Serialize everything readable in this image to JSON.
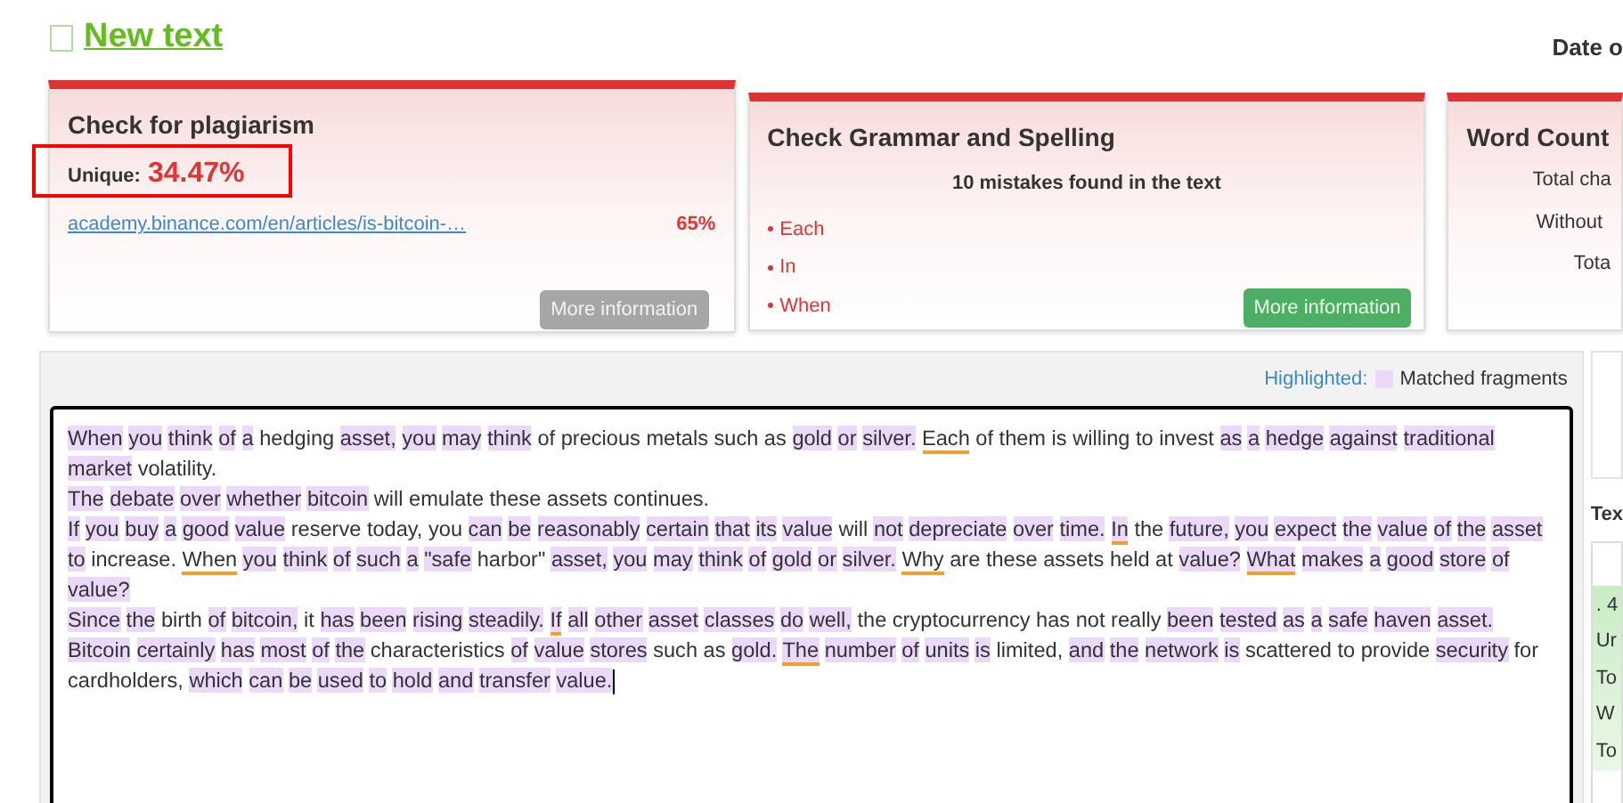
{
  "header": {
    "title": "New text",
    "checked": false,
    "date_label": "Date o"
  },
  "plagiarism": {
    "title": "Check for plagiarism",
    "unique_label": "Unique:",
    "unique_value": "34.47%",
    "sources": [
      {
        "url": "academy.binance.com/en/articles/is-bitcoin-…",
        "percent": "65%"
      }
    ],
    "button": "More information"
  },
  "grammar": {
    "title": "Check Grammar and Spelling",
    "summary": "10 mistakes found in the text",
    "mistakes": [
      "Each",
      "In",
      "When"
    ],
    "button": "More information"
  },
  "word_count": {
    "title": "Word Count",
    "rows": [
      "Total cha",
      "Without",
      "Tota"
    ]
  },
  "editor": {
    "legend_label": "Highlighted:",
    "legend_text": "Matched fragments",
    "paragraphs": [
      [
        {
          "text": "When",
          "kind": "match"
        },
        {
          "text": "you",
          "kind": "match"
        },
        {
          "text": "think",
          "kind": "match"
        },
        {
          "text": "of",
          "kind": "match"
        },
        {
          "text": "a",
          "kind": "match"
        },
        {
          "text": "hedging",
          "kind": "plain"
        },
        {
          "text": "asset,",
          "kind": "match"
        },
        {
          "text": "you",
          "kind": "match"
        },
        {
          "text": "may",
          "kind": "match"
        },
        {
          "text": "think",
          "kind": "match"
        },
        {
          "text": "of precious metals such as",
          "kind": "plain"
        },
        {
          "text": "gold",
          "kind": "match"
        },
        {
          "text": "or",
          "kind": "match"
        },
        {
          "text": "silver.",
          "kind": "match"
        },
        {
          "text": "Each",
          "kind": "error"
        },
        {
          "text": "of them is willing to invest",
          "kind": "plain"
        },
        {
          "text": "as",
          "kind": "match"
        },
        {
          "text": "a",
          "kind": "match"
        },
        {
          "text": "hedge",
          "kind": "match"
        },
        {
          "text": "against",
          "kind": "match"
        },
        {
          "text": "traditional",
          "kind": "match"
        },
        {
          "text": "market",
          "kind": "match"
        },
        {
          "text": "volatility.",
          "kind": "plain"
        }
      ],
      [
        {
          "text": "The",
          "kind": "match"
        },
        {
          "text": "debate",
          "kind": "match"
        },
        {
          "text": "over",
          "kind": "match"
        },
        {
          "text": "whether",
          "kind": "match"
        },
        {
          "text": "bitcoin",
          "kind": "match"
        },
        {
          "text": "will emulate these assets continues.",
          "kind": "plain"
        }
      ],
      [
        {
          "text": "If",
          "kind": "match"
        },
        {
          "text": "you",
          "kind": "match"
        },
        {
          "text": "buy",
          "kind": "match"
        },
        {
          "text": "a",
          "kind": "match"
        },
        {
          "text": "good",
          "kind": "match"
        },
        {
          "text": "value",
          "kind": "match"
        },
        {
          "text": "reserve today, you",
          "kind": "plain"
        },
        {
          "text": "can",
          "kind": "match"
        },
        {
          "text": "be",
          "kind": "match"
        },
        {
          "text": "reasonably",
          "kind": "match"
        },
        {
          "text": "certain",
          "kind": "match"
        },
        {
          "text": "that",
          "kind": "match"
        },
        {
          "text": "its",
          "kind": "match"
        },
        {
          "text": "value",
          "kind": "match"
        },
        {
          "text": "will",
          "kind": "plain"
        },
        {
          "text": "not",
          "kind": "match"
        },
        {
          "text": "depreciate",
          "kind": "match"
        },
        {
          "text": "over",
          "kind": "match"
        },
        {
          "text": "time.",
          "kind": "match"
        },
        {
          "text": "In",
          "kind": "match_error"
        },
        {
          "text": "the",
          "kind": "plain"
        },
        {
          "text": "future,",
          "kind": "match"
        },
        {
          "text": "you",
          "kind": "match"
        },
        {
          "text": "expect",
          "kind": "match"
        },
        {
          "text": "the",
          "kind": "match"
        },
        {
          "text": "value",
          "kind": "match"
        },
        {
          "text": "of",
          "kind": "match"
        },
        {
          "text": "the",
          "kind": "match"
        },
        {
          "text": "asset",
          "kind": "match"
        },
        {
          "text": "to",
          "kind": "match"
        },
        {
          "text": "increase.",
          "kind": "plain"
        },
        {
          "text": "When",
          "kind": "error"
        },
        {
          "text": "you",
          "kind": "match"
        },
        {
          "text": "think",
          "kind": "match"
        },
        {
          "text": "of",
          "kind": "match"
        },
        {
          "text": "such",
          "kind": "match"
        },
        {
          "text": "a",
          "kind": "match"
        },
        {
          "text": "\"safe",
          "kind": "match"
        },
        {
          "text": "harbor\"",
          "kind": "plain"
        },
        {
          "text": "asset,",
          "kind": "match"
        },
        {
          "text": "you",
          "kind": "match"
        },
        {
          "text": "may",
          "kind": "match"
        },
        {
          "text": "think",
          "kind": "match"
        },
        {
          "text": "of",
          "kind": "match"
        },
        {
          "text": "gold",
          "kind": "match"
        },
        {
          "text": "or",
          "kind": "match"
        },
        {
          "text": "silver.",
          "kind": "match"
        },
        {
          "text": "Why",
          "kind": "error"
        },
        {
          "text": "are these assets held at",
          "kind": "plain"
        },
        {
          "text": "value?",
          "kind": "match"
        },
        {
          "text": "What",
          "kind": "match_error"
        },
        {
          "text": "makes",
          "kind": "match"
        },
        {
          "text": "a",
          "kind": "match"
        },
        {
          "text": "good",
          "kind": "match"
        },
        {
          "text": "store",
          "kind": "match"
        },
        {
          "text": "of",
          "kind": "match"
        },
        {
          "text": "value?",
          "kind": "match"
        }
      ],
      [
        {
          "text": "Since",
          "kind": "match"
        },
        {
          "text": "the",
          "kind": "match"
        },
        {
          "text": "birth",
          "kind": "plain"
        },
        {
          "text": "of",
          "kind": "match"
        },
        {
          "text": "bitcoin,",
          "kind": "match"
        },
        {
          "text": "it",
          "kind": "plain"
        },
        {
          "text": "has",
          "kind": "match"
        },
        {
          "text": "been",
          "kind": "match"
        },
        {
          "text": "rising",
          "kind": "match"
        },
        {
          "text": "steadily.",
          "kind": "match"
        },
        {
          "text": "If",
          "kind": "match_error"
        },
        {
          "text": "all",
          "kind": "match"
        },
        {
          "text": "other",
          "kind": "match"
        },
        {
          "text": "asset",
          "kind": "match"
        },
        {
          "text": "classes",
          "kind": "match"
        },
        {
          "text": "do",
          "kind": "match"
        },
        {
          "text": "well,",
          "kind": "match"
        },
        {
          "text": "the cryptocurrency has not really",
          "kind": "plain"
        },
        {
          "text": "been",
          "kind": "match"
        },
        {
          "text": "tested",
          "kind": "match"
        },
        {
          "text": "as",
          "kind": "match"
        },
        {
          "text": "a",
          "kind": "match"
        },
        {
          "text": "safe",
          "kind": "match"
        },
        {
          "text": "haven",
          "kind": "match"
        },
        {
          "text": "asset.",
          "kind": "match"
        }
      ],
      [
        {
          "text": "Bitcoin",
          "kind": "match"
        },
        {
          "text": "certainly",
          "kind": "match"
        },
        {
          "text": "has",
          "kind": "match"
        },
        {
          "text": "most",
          "kind": "match"
        },
        {
          "text": "of",
          "kind": "match"
        },
        {
          "text": "the",
          "kind": "match"
        },
        {
          "text": "characteristics",
          "kind": "plain"
        },
        {
          "text": "of",
          "kind": "match"
        },
        {
          "text": "value",
          "kind": "match"
        },
        {
          "text": "stores",
          "kind": "match"
        },
        {
          "text": "such as",
          "kind": "plain"
        },
        {
          "text": "gold.",
          "kind": "match"
        },
        {
          "text": "The",
          "kind": "match_error"
        },
        {
          "text": "number",
          "kind": "match"
        },
        {
          "text": "of",
          "kind": "match"
        },
        {
          "text": "units",
          "kind": "match"
        },
        {
          "text": "is",
          "kind": "match"
        },
        {
          "text": "limited,",
          "kind": "plain"
        },
        {
          "text": "and",
          "kind": "match"
        },
        {
          "text": "the",
          "kind": "match"
        },
        {
          "text": "network",
          "kind": "match"
        },
        {
          "text": "is",
          "kind": "match"
        },
        {
          "text": "scattered to provide",
          "kind": "plain"
        },
        {
          "text": "security",
          "kind": "match"
        },
        {
          "text": "for",
          "kind": "plain"
        },
        {
          "text": "cardholders,",
          "kind": "plain"
        },
        {
          "text": "which",
          "kind": "match"
        },
        {
          "text": "can",
          "kind": "match"
        },
        {
          "text": "be",
          "kind": "match"
        },
        {
          "text": "used",
          "kind": "match"
        },
        {
          "text": "to",
          "kind": "match"
        },
        {
          "text": "hold",
          "kind": "match"
        },
        {
          "text": "and",
          "kind": "match"
        },
        {
          "text": "transfer",
          "kind": "match"
        },
        {
          "text": "value.",
          "kind": "match"
        }
      ]
    ]
  },
  "side": {
    "heading": "Tex",
    "rows": [
      ". 4",
      "Ur",
      "To",
      "W",
      "To"
    ]
  }
}
